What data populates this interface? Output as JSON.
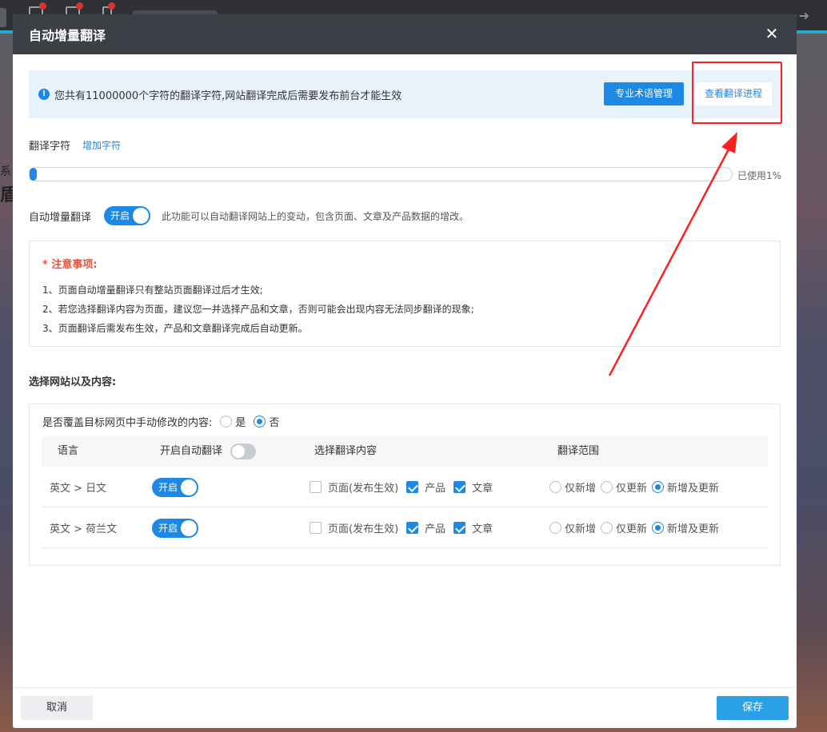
{
  "modal": {
    "title": "自动增量翻译",
    "close_symbol": "✕"
  },
  "info_bar": {
    "icon": "info-icon",
    "message": "您共有11000000个字符的翻译字符,网站翻译完成后需要发布前台才能生效",
    "terms_button": "专业术语管理",
    "progress_button": "查看翻译进程"
  },
  "quota": {
    "label": "翻译字符",
    "add_link": "增加字符",
    "used_text": "已使用1%",
    "used_percent": 1
  },
  "auto_translate": {
    "label": "自动增量翻译",
    "switch_text": "开启",
    "description": "此功能可以自动翻译网站上的变动，包含页面、文章及产品数据的增改。"
  },
  "notice": {
    "title": "* 注意事项:",
    "items": [
      "1、页面自动增量翻译只有整站页面翻译过后才生效;",
      "2、若您选择翻译内容为页面，建议您一并选择产品和文章，否则可能会出现内容无法同步翻译的现象;",
      "3、页面翻译后需发布生效，产品和文章翻译完成后自动更新。"
    ]
  },
  "section": {
    "title": "选择网站以及内容:"
  },
  "overwrite": {
    "label": "是否覆盖目标网页中手动修改的内容:",
    "yes": "是",
    "no": "否",
    "selected": "否"
  },
  "table": {
    "headers": {
      "language": "语言",
      "auto": "开启自动翻译",
      "content": "选择翻译内容",
      "range": "翻译范围"
    },
    "rows": [
      {
        "language": "英文 > 日文",
        "switch_text": "开启",
        "content_options": [
          "页面(发布生效)",
          "产品",
          "文章"
        ],
        "content_checked": [
          false,
          true,
          true
        ],
        "range_options": [
          "仅新增",
          "仅更新",
          "新增及更新"
        ],
        "range_selected": "新增及更新"
      },
      {
        "language": "英文 > 荷兰文",
        "switch_text": "开启",
        "content_options": [
          "页面(发布生效)",
          "产品",
          "文章"
        ],
        "content_checked": [
          false,
          true,
          true
        ],
        "range_options": [
          "仅新增",
          "仅更新",
          "新增及更新"
        ],
        "range_selected": "新增及更新"
      }
    ]
  },
  "footer": {
    "cancel": "取消",
    "save": "保存"
  },
  "background": {
    "text1": "系",
    "text2": "盾"
  },
  "colors": {
    "primary": "#1e88e5",
    "header_bg": "#3c3f45",
    "info_bg": "#e8f2fb",
    "notice_red": "#e5533d",
    "save_bg": "#2aa0e6",
    "annotation_red": "#ff2020"
  }
}
